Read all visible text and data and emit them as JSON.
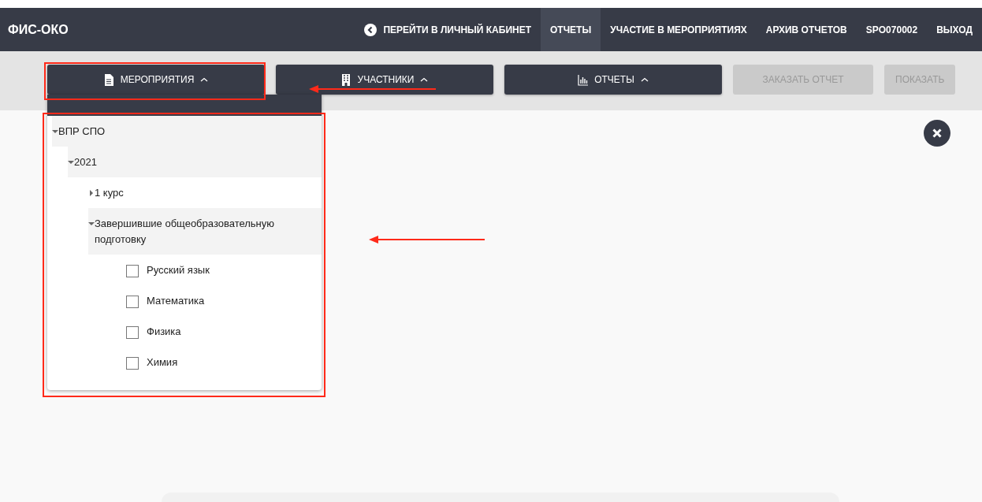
{
  "header": {
    "brand": "ФИС-ОКО",
    "nav": [
      {
        "label": "ПЕРЕЙТИ В ЛИЧНЫЙ КАБИНЕТ",
        "kind": "back",
        "selected": false
      },
      {
        "label": "ОТЧЕТЫ",
        "kind": "link",
        "selected": true
      },
      {
        "label": "УЧАСТИЕ В МЕРОПРИЯТИЯХ",
        "kind": "link",
        "selected": false
      },
      {
        "label": "АРХИВ ОТЧЕТОВ",
        "kind": "link",
        "selected": false
      },
      {
        "label": "SPO070002",
        "kind": "link",
        "selected": false
      },
      {
        "label": "ВЫХОД",
        "kind": "link",
        "selected": false
      }
    ]
  },
  "toolbar": [
    {
      "label": "МЕРОПРИЯТИЯ",
      "kind": "dropdown",
      "expanded": true,
      "disabled": false
    },
    {
      "label": "УЧАСТНИКИ",
      "kind": "dropdown",
      "expanded": true,
      "disabled": false
    },
    {
      "label": "ОТЧЕТЫ",
      "kind": "dropdown",
      "expanded": true,
      "disabled": false
    },
    {
      "label": "ЗАКАЗАТЬ ОТЧЕТ",
      "kind": "action",
      "disabled": true
    },
    {
      "label": "ПОКАЗАТЬ",
      "kind": "action",
      "disabled": true
    }
  ],
  "tree": [
    {
      "label": "ВПР СПО",
      "expanded": true,
      "children": [
        {
          "label": "2021",
          "expanded": true,
          "children": [
            {
              "label": "1 курс",
              "expanded": false
            },
            {
              "label": "Завершившие общеобразовательную подготовку",
              "expanded": true,
              "children": [
                {
                  "label": "Русский язык",
                  "checked": false
                },
                {
                  "label": "Математика",
                  "checked": false
                },
                {
                  "label": "Физика",
                  "checked": false
                },
                {
                  "label": "Химия",
                  "checked": false
                }
              ]
            }
          ]
        }
      ]
    }
  ]
}
